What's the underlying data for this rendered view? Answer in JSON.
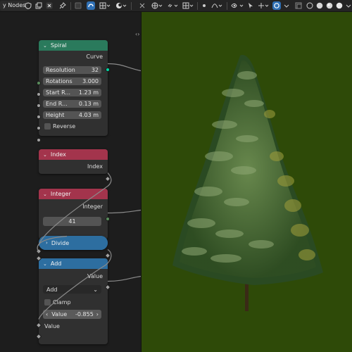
{
  "toolbar": {
    "editor_title": "y Nodes",
    "icons": [
      "shield-icon",
      "copy-icon",
      "close-icon",
      "pin-icon",
      "mode-icon",
      "snap-icon",
      "grid-icon",
      "overlay-icon",
      "view-icon",
      "globe-icon",
      "link-icon",
      "shading-icon",
      "visibility-icon",
      "gizmo-icon",
      "render-icon"
    ]
  },
  "nodes": {
    "spiral": {
      "title": "Spiral",
      "output": "Curve",
      "fields": [
        {
          "label": "Resolution",
          "value": "32"
        },
        {
          "label": "Rotations",
          "value": "3.000"
        },
        {
          "label": "Start R...",
          "value": "1.23 m"
        },
        {
          "label": "End R...",
          "value": "0.13 m"
        },
        {
          "label": "Height",
          "value": "4.03 m"
        }
      ],
      "checkbox": "Reverse"
    },
    "index": {
      "title": "Index",
      "output": "Index"
    },
    "integer": {
      "title": "Integer",
      "output": "Integer",
      "value": "41"
    },
    "divide": {
      "title": "Divide"
    },
    "add": {
      "title": "Add",
      "output": "Value",
      "operation": "Add",
      "checkbox": "Clamp",
      "value_label": "Value",
      "value": "-0.855",
      "input_label": "Value"
    }
  },
  "colors": {
    "spiral_header": "#2a7a5c",
    "integer_header": "#a3344c",
    "math_header": "#2d6ea0",
    "viewport_bg": "#2e4a08"
  }
}
